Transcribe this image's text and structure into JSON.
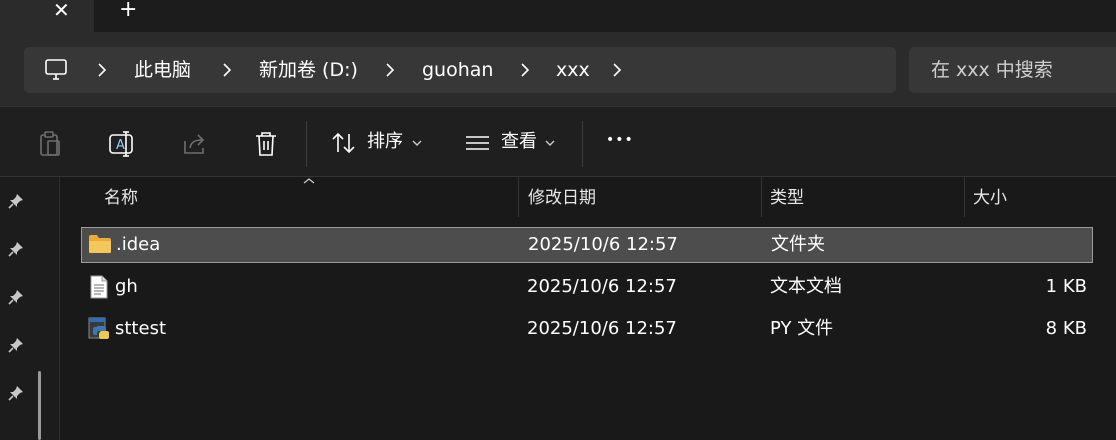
{
  "tabs": {
    "close_glyph": "✕",
    "new_tab_glyph": "+"
  },
  "breadcrumb": {
    "items": [
      "此电脑",
      "新加卷 (D:)",
      "guohan",
      "xxx"
    ]
  },
  "search": {
    "placeholder": "在 xxx 中搜索"
  },
  "toolbar": {
    "sort_label": "排序",
    "view_label": "查看",
    "more_glyph": "•••"
  },
  "columns": [
    "名称",
    "修改日期",
    "类型",
    "大小"
  ],
  "files": [
    {
      "name": ".idea",
      "date": "2025/10/6 12:57",
      "type": "文件夹",
      "size": "",
      "icon": "folder-icon",
      "selected": true
    },
    {
      "name": "gh",
      "date": "2025/10/6 12:57",
      "type": "文本文档",
      "size": "1 KB",
      "icon": "text-file-icon",
      "selected": false
    },
    {
      "name": "sttest",
      "date": "2025/10/6 12:57",
      "type": "PY 文件",
      "size": "8 KB",
      "icon": "python-file-icon",
      "selected": false
    }
  ],
  "colors": {
    "folder": "#f4c75a",
    "selection": "#4d4d4d",
    "background": "#191919"
  }
}
